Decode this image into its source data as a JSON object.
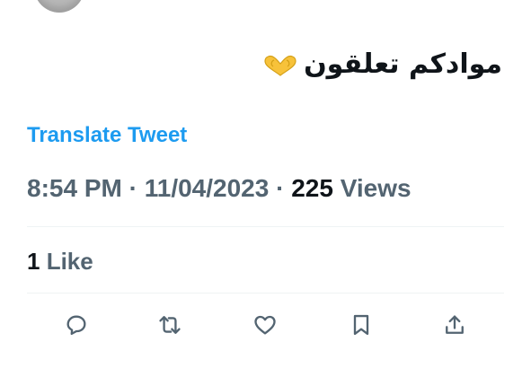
{
  "tweet": {
    "text": "موادكم تعلقون",
    "emoji_icon": "heart-hands-icon"
  },
  "translate": {
    "label": "Translate Tweet"
  },
  "meta": {
    "time": "8:54 PM",
    "separator": "·",
    "date": "11/04/2023",
    "views_count": "225",
    "views_label": "Views"
  },
  "engagement": {
    "likes_count": "1",
    "likes_label": "Like"
  },
  "actions": [
    {
      "name": "reply",
      "icon": "comment-icon"
    },
    {
      "name": "retweet",
      "icon": "retweet-icon"
    },
    {
      "name": "like",
      "icon": "heart-icon"
    },
    {
      "name": "bookmark",
      "icon": "bookmark-icon"
    },
    {
      "name": "share",
      "icon": "share-icon"
    }
  ],
  "colors": {
    "link": "#1d9bf0",
    "text_primary": "#0f1419",
    "text_secondary": "#536471",
    "divider": "#eff3f4",
    "emoji": "#f7c23a"
  }
}
